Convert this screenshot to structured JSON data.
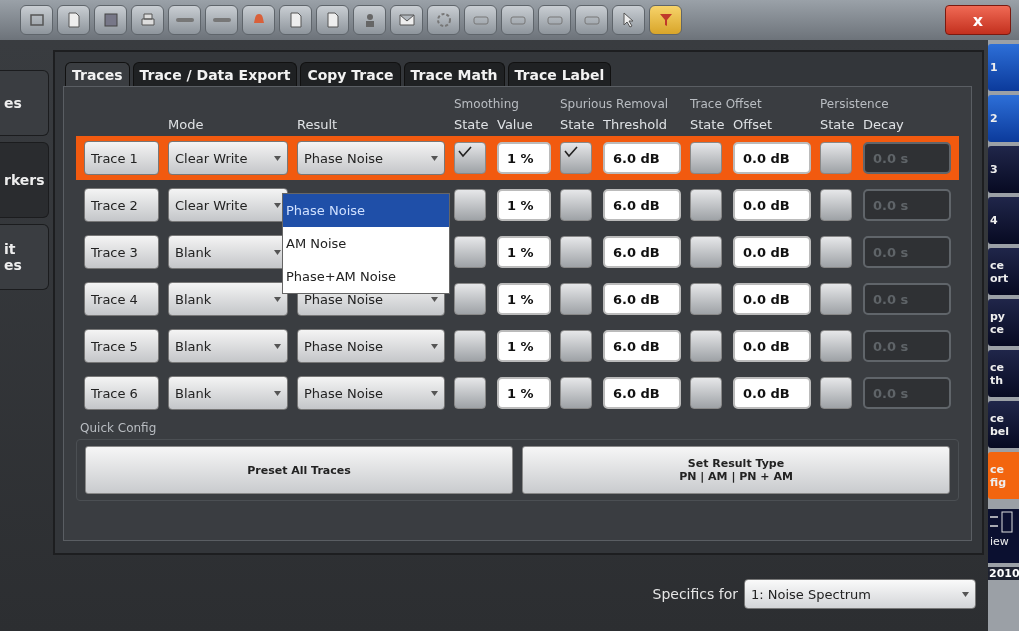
{
  "toolbar": {
    "close": "x"
  },
  "left_tabs": [
    {
      "lines": [
        "es"
      ],
      "selected": false
    },
    {
      "lines": [
        "rkers"
      ],
      "selected": true
    },
    {
      "lines": [
        "it",
        "es"
      ],
      "selected": false
    }
  ],
  "dialog": {
    "tabs": [
      {
        "label": "Traces",
        "selected": true
      },
      {
        "label": "Trace / Data Export",
        "selected": false
      },
      {
        "label": "Copy Trace",
        "selected": false
      },
      {
        "label": "Trace Math",
        "selected": false
      },
      {
        "label": "Trace Label",
        "selected": false
      }
    ],
    "groups": [
      "Smoothing",
      "Spurious Removal",
      "Trace Offset",
      "Persistence"
    ],
    "columns": [
      "Mode",
      "Result",
      "State",
      "Value",
      "State",
      "Threshold",
      "State",
      "Offset",
      "State",
      "Decay"
    ],
    "rows": [
      {
        "trace": "Trace 1",
        "selected": true,
        "mode": "Clear Write",
        "result": "Phase Noise",
        "smoothing_on": true,
        "smoothing": "1 %",
        "spur_on": true,
        "threshold": "6.0 dB",
        "offset_on": false,
        "offset": "0.0 dB",
        "persistence_on": false,
        "decay": "0.0 s",
        "decay_disabled": true
      },
      {
        "trace": "Trace 2",
        "selected": false,
        "mode": "Clear Write",
        "smoothing_on": false,
        "smoothing": "1 %",
        "spur_on": false,
        "threshold": "6.0 dB",
        "offset_on": false,
        "offset": "0.0 dB",
        "persistence_on": false,
        "decay": "0.0 s",
        "decay_disabled": true
      },
      {
        "trace": "Trace 3",
        "selected": false,
        "mode": "Blank",
        "smoothing_on": false,
        "smoothing": "1 %",
        "spur_on": false,
        "threshold": "6.0 dB",
        "offset_on": false,
        "offset": "0.0 dB",
        "persistence_on": false,
        "decay": "0.0 s",
        "decay_disabled": true
      },
      {
        "trace": "Trace 4",
        "selected": false,
        "mode": "Blank",
        "result": "Phase Noise",
        "smoothing_on": false,
        "smoothing": "1 %",
        "spur_on": false,
        "threshold": "6.0 dB",
        "offset_on": false,
        "offset": "0.0 dB",
        "persistence_on": false,
        "decay": "0.0 s",
        "decay_disabled": true
      },
      {
        "trace": "Trace 5",
        "selected": false,
        "mode": "Blank",
        "result": "Phase Noise",
        "smoothing_on": false,
        "smoothing": "1 %",
        "spur_on": false,
        "threshold": "6.0 dB",
        "offset_on": false,
        "offset": "0.0 dB",
        "persistence_on": false,
        "decay": "0.0 s",
        "decay_disabled": true
      },
      {
        "trace": "Trace 6",
        "selected": false,
        "mode": "Blank",
        "result": "Phase Noise",
        "smoothing_on": false,
        "smoothing": "1 %",
        "spur_on": false,
        "threshold": "6.0 dB",
        "offset_on": false,
        "offset": "0.0 dB",
        "persistence_on": false,
        "decay": "0.0 s",
        "decay_disabled": true
      }
    ],
    "dropdown": {
      "options": [
        {
          "label": "Phase Noise",
          "selected": true
        },
        {
          "label": "AM Noise",
          "selected": false
        },
        {
          "label": "Phase+AM Noise",
          "selected": false
        }
      ]
    },
    "quick_config": {
      "label": "Quick Config",
      "buttons": [
        {
          "lines": [
            "Preset All Traces"
          ]
        },
        {
          "lines": [
            "Set Result Type",
            "PN | AM | PN + AM"
          ]
        }
      ]
    }
  },
  "specifics": {
    "label": "Specifics for",
    "value": "1: Noise Spectrum"
  },
  "softkeys": [
    {
      "lines": [
        "1"
      ],
      "active": true,
      "selected": false
    },
    {
      "lines": [
        "2"
      ],
      "active": true,
      "selected": false
    },
    {
      "lines": [
        "3"
      ],
      "active": false,
      "selected": false
    },
    {
      "lines": [
        "4"
      ],
      "active": false,
      "selected": false
    },
    {
      "lines": [
        "ce",
        "ort"
      ],
      "active": false,
      "selected": false
    },
    {
      "lines": [
        "py",
        "ce"
      ],
      "active": false,
      "selected": false
    },
    {
      "lines": [
        "ce",
        "th"
      ],
      "active": false,
      "selected": false
    },
    {
      "lines": [
        "ce",
        "bel"
      ],
      "active": false,
      "selected": false
    },
    {
      "lines": [
        "ce",
        "fig"
      ],
      "active": false,
      "selected": true
    }
  ],
  "view_key": "iew",
  "date": "2010"
}
